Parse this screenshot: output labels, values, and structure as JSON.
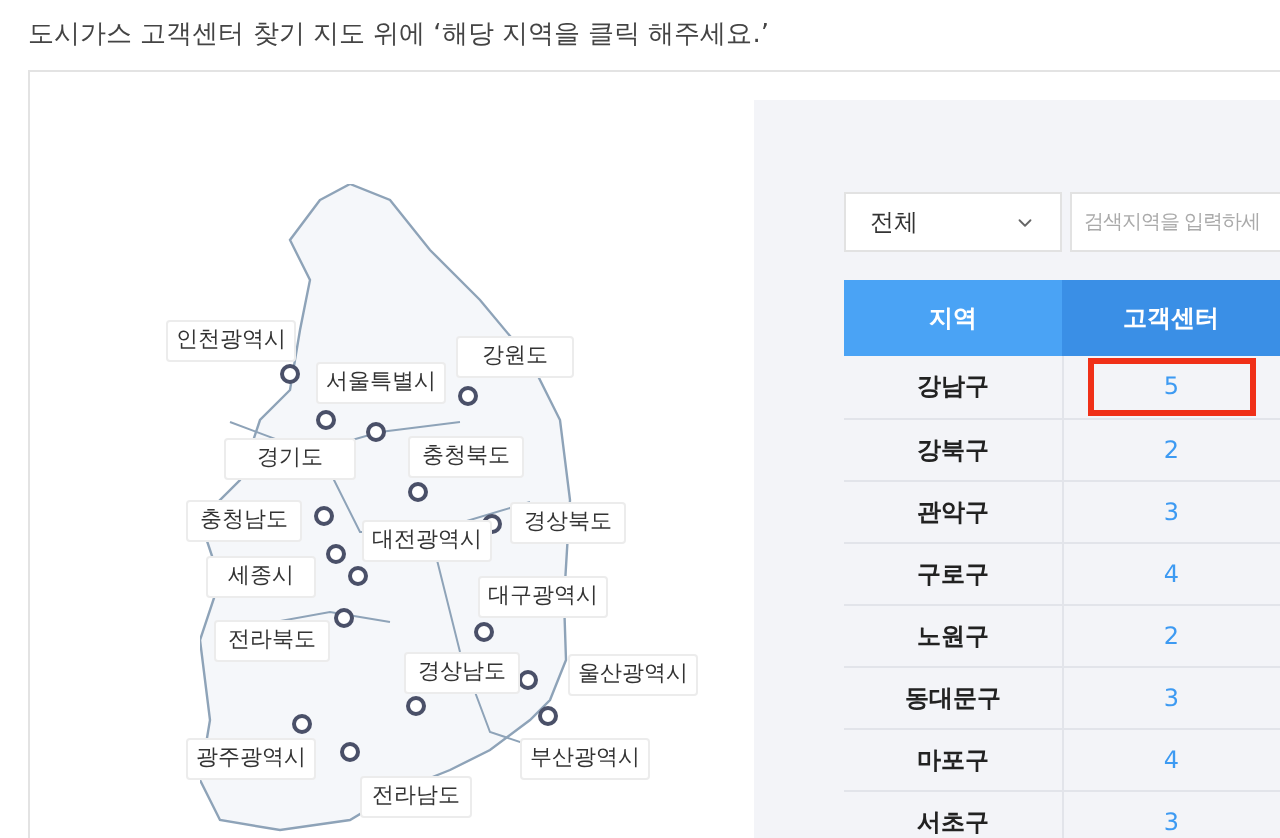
{
  "instruction": "도시가스 고객센터 찾기 지도 위에 ‘해당 지역을 클릭 해주세요.’",
  "map": {
    "regions": [
      {
        "name": "인천광역시"
      },
      {
        "name": "서울특별시"
      },
      {
        "name": "강원도"
      },
      {
        "name": "경기도"
      },
      {
        "name": "충청북도"
      },
      {
        "name": "충청남도"
      },
      {
        "name": "경상북도"
      },
      {
        "name": "대전광역시"
      },
      {
        "name": "세종시"
      },
      {
        "name": "대구광역시"
      },
      {
        "name": "전라북도"
      },
      {
        "name": "경상남도"
      },
      {
        "name": "울산광역시"
      },
      {
        "name": "광주광역시"
      },
      {
        "name": "부산광역시"
      },
      {
        "name": "전라남도"
      }
    ]
  },
  "filter": {
    "value": "전체"
  },
  "search": {
    "placeholder": "검색지역을 입력하세"
  },
  "table": {
    "columns": [
      "지역",
      "고객센터"
    ],
    "rows": [
      {
        "region": "강남구",
        "count": "5",
        "highlighted": true
      },
      {
        "region": "강북구",
        "count": "2",
        "highlighted": false
      },
      {
        "region": "관악구",
        "count": "3",
        "highlighted": false
      },
      {
        "region": "구로구",
        "count": "4",
        "highlighted": false
      },
      {
        "region": "노원구",
        "count": "2",
        "highlighted": false
      },
      {
        "region": "동대문구",
        "count": "3",
        "highlighted": false
      },
      {
        "region": "마포구",
        "count": "4",
        "highlighted": false
      },
      {
        "region": "서초구",
        "count": "3",
        "highlighted": false
      }
    ]
  }
}
